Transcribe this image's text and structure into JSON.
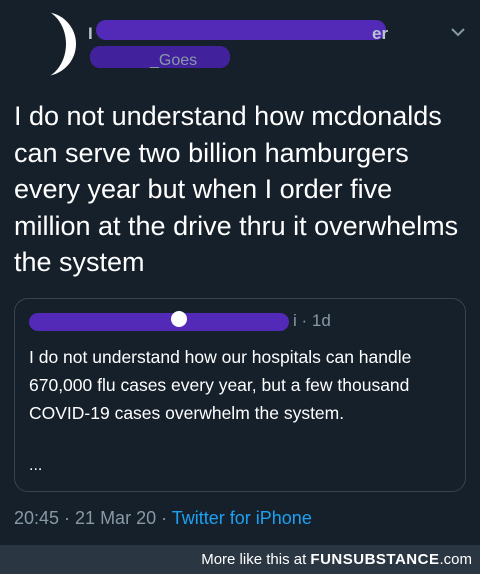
{
  "tweet": {
    "author_name": "I",
    "author_suffix": "er",
    "author_handle": "_Goes",
    "text": "I do not understand how mcdonalds can serve two billion hamburgers every year but when I order five million at the drive thru it overwhelms the system",
    "timestamp": "20:45 · 21 Mar 20 · ",
    "source": "Twitter for iPhone",
    "menu_icon": "chevron-down-icon"
  },
  "quoted_tweet": {
    "meta": "i · 1d",
    "text": "I do not understand how our hospitals can handle 670,000 flu cases every year, but a few thousand COVID-19 cases overwhelm the system.",
    "more": "..."
  },
  "footer": {
    "prefix": "More like this at ",
    "brand": "FUNSUBSTANCE",
    "suffix": ".com"
  },
  "colors": {
    "background": "#15202b",
    "text": "#ffffff",
    "secondary_text": "#8899a6",
    "link": "#1da1f2",
    "redaction": "#5a2bc8"
  }
}
